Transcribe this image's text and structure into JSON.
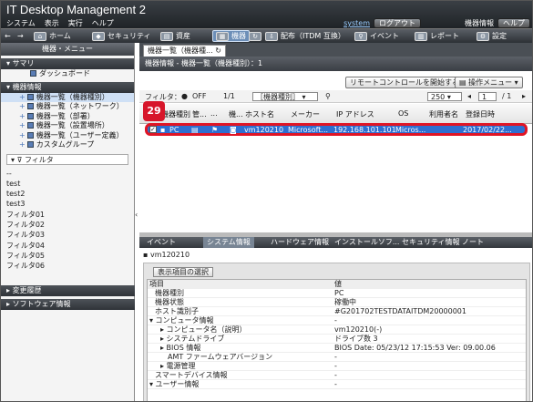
{
  "app_title": "IT Desktop Management 2",
  "menus": [
    "システム",
    "表示",
    "実行",
    "ヘルプ"
  ],
  "user": {
    "name": "system",
    "logout": "ログアウト",
    "info": "機器情報",
    "help": "ヘルプ"
  },
  "nav": {
    "back": "←",
    "forward": "→",
    "home": "ホーム",
    "security": "セキュリティ",
    "assets": "資産",
    "devices": "機器",
    "distribution": "配布（ITDM 互換）",
    "events": "イベント",
    "reports": "レポート",
    "settings": "設定"
  },
  "sidebar": {
    "title": "機器・メニュー",
    "summary": {
      "header": "サマリ",
      "items": [
        "ダッシュボード"
      ]
    },
    "device_info": {
      "header": "機器情報",
      "items": [
        "機器一覧（機器種別）",
        "機器一覧（ネットワーク）",
        "機器一覧（部署）",
        "機器一覧（設置場所）",
        "機器一覧（ユーザー定義）",
        "カスタムグループ"
      ]
    },
    "filter_label": "フィルタ",
    "filters": [
      "--",
      "test",
      "test2",
      "test3",
      "フィルタ01",
      "フィルタ02",
      "フィルタ03",
      "フィルタ04",
      "フィルタ05",
      "フィルタ06"
    ],
    "change_history": "変更履歴",
    "software_info": "ソフトウェア情報"
  },
  "main": {
    "tab_label": "機器一覧（機器種...",
    "breadcrumb": "機器情報 - 機器一覧（機器種別）：1",
    "remote_button": "リモートコントロールを開始する",
    "ops_menu": "操作メニュー",
    "filter_label": "フィルタ：",
    "filter_state": "OFF",
    "count": "1/1",
    "type_select": "［機器種別］",
    "page_size": "250",
    "page_current": "1",
    "page_total": "/ 1",
    "columns": [
      "機器種別",
      "管...",
      "...",
      "機...",
      "ホスト名",
      "メーカー",
      "IP アドレス",
      "OS",
      "利用者名",
      "登録日時"
    ],
    "row": {
      "type": "PC",
      "host": "vm120210",
      "maker": "Microsoft...",
      "ip": "192.168.101.101",
      "os": "Micros...",
      "user": "",
      "date": "2017/02/22..."
    },
    "callout": "29"
  },
  "details": {
    "tabs": [
      "イベント",
      "システム情報",
      "ハードウェア情報",
      "インストールソフ...",
      "セキュリティ情報",
      "ノート"
    ],
    "host": "vm120210",
    "select_button": "表示項目の選択",
    "header": {
      "k": "項目",
      "v": "値"
    },
    "rows": [
      {
        "k": "機器種別",
        "v": "PC"
      },
      {
        "k": "機器状態",
        "v": "稼働中"
      },
      {
        "k": "ホスト識別子",
        "v": "#G201702TESTDATAITDM20000001"
      },
      {
        "k": "▾ コンピュータ情報",
        "v": "-"
      },
      {
        "k": "▸ コンピュータ名（説明）",
        "v": "vm120210(-)"
      },
      {
        "k": "▸ システムドライブ",
        "v": "ドライブ数 3"
      },
      {
        "k": "▸ BIOS 情報",
        "v": "BIOS Date: 05/23/12 17:15:53 Ver: 09.00.06"
      },
      {
        "k": "AMT ファームウェアバージョン",
        "v": "-"
      },
      {
        "k": "▸ 電源管理",
        "v": "-"
      },
      {
        "k": "スマートデバイス情報",
        "v": "-"
      },
      {
        "k": "▾ ユーザー情報",
        "v": "-"
      }
    ]
  }
}
